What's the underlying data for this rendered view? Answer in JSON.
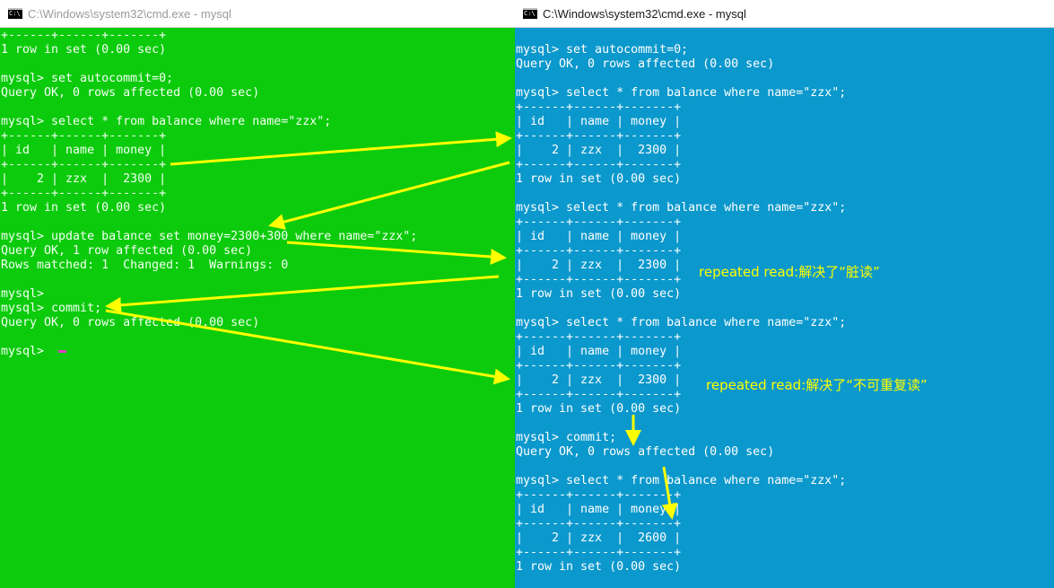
{
  "left_window": {
    "title": "C:\\Windows\\system32\\cmd.exe - mysql",
    "lines": [
      "+------+------+-------+",
      "1 row in set (0.00 sec)",
      "",
      "mysql> set autocommit=0;",
      "Query OK, 0 rows affected (0.00 sec)",
      "",
      "mysql> select * from balance where name=\"zzx\";",
      "+------+------+-------+",
      "| id   | name | money |",
      "+------+------+-------+",
      "|    2 | zzx  |  2300 |",
      "+------+------+-------+",
      "1 row in set (0.00 sec)",
      "",
      "mysql> update balance set money=2300+300 where name=\"zzx\";",
      "Query OK, 1 row affected (0.00 sec)",
      "Rows matched: 1  Changed: 1  Warnings: 0",
      "",
      "mysql>",
      "mysql> commit;",
      "Query OK, 0 rows affected (0.00 sec)",
      "",
      "mysql> "
    ]
  },
  "right_window": {
    "title": "C:\\Windows\\system32\\cmd.exe - mysql",
    "lines": [
      "",
      "mysql> set autocommit=0;",
      "Query OK, 0 rows affected (0.00 sec)",
      "",
      "mysql> select * from balance where name=\"zzx\";",
      "+------+------+-------+",
      "| id   | name | money |",
      "+------+------+-------+",
      "|    2 | zzx  |  2300 |",
      "+------+------+-------+",
      "1 row in set (0.00 sec)",
      "",
      "mysql> select * from balance where name=\"zzx\";",
      "+------+------+-------+",
      "| id   | name | money |",
      "+------+------+-------+",
      "|    2 | zzx  |  2300 |",
      "+------+------+-------+",
      "1 row in set (0.00 sec)",
      "",
      "mysql> select * from balance where name=\"zzx\";",
      "+------+------+-------+",
      "| id   | name | money |",
      "+------+------+-------+",
      "|    2 | zzx  |  2300 |",
      "+------+------+-------+",
      "1 row in set (0.00 sec)",
      "",
      "mysql> commit;",
      "Query OK, 0 rows affected (0.00 sec)",
      "",
      "mysql> select * from balance where name=\"zzx\";",
      "+------+------+-------+",
      "| id   | name | money |",
      "+------+------+-------+",
      "|    2 | zzx  |  2600 |",
      "+------+------+-------+",
      "1 row in set (0.00 sec)"
    ]
  },
  "annotations": {
    "dirty_read": "repeated read:解决了“脏读”",
    "non_repeatable_read": "repeated read:解决了“不可重复读”"
  },
  "colors": {
    "left_console_bg": "#0ccb0c",
    "right_console_bg": "#0b98cc",
    "arrow": "#ffff00",
    "annotation_text": "#ffff00"
  }
}
